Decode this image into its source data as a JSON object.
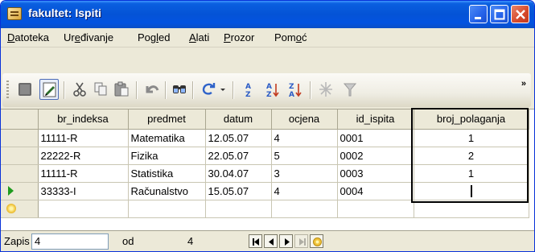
{
  "window": {
    "title": "fakultet: Ispiti"
  },
  "menu": {
    "items": [
      {
        "pre": "",
        "ul": "D",
        "post": "atoteka"
      },
      {
        "pre": "Ur",
        "ul": "e",
        "post": "đivanje"
      },
      {
        "pre": "Pog",
        "ul": "l",
        "post": "ed"
      },
      {
        "pre": "",
        "ul": "A",
        "post": "lati"
      },
      {
        "pre": "",
        "ul": "P",
        "post": "rozor"
      },
      {
        "pre": "Pom",
        "ul": "o",
        "post": "ć"
      }
    ]
  },
  "toolbar": {
    "icons": [
      "view-icon",
      "design-view-icon",
      "cut-icon",
      "copy-icon",
      "paste-icon",
      "undo-icon",
      "find-icon",
      "redo-icon",
      "sort-ascending-icon",
      "sort-descending-icon",
      "filter-by-selection-icon",
      "filter-icon"
    ],
    "overflow": "»"
  },
  "grid": {
    "columns": [
      "br_indeksa",
      "predmet",
      "datum",
      "ocjena",
      "id_ispita",
      "broj_polaganja"
    ],
    "rows": [
      [
        "11111-R",
        "Matematika",
        "12.05.07",
        "4",
        "0001",
        "1"
      ],
      [
        "22222-R",
        "Fizika",
        "22.05.07",
        "5",
        "0002",
        "2"
      ],
      [
        "11111-R",
        "Statistika",
        "30.04.07",
        "3",
        "0003",
        "1"
      ],
      [
        "33333-I",
        "Računalstvo",
        "15.05.07",
        "4",
        "0004",
        ""
      ]
    ]
  },
  "status": {
    "record_label": "Zapis",
    "current_record": "4",
    "of_label": "od",
    "total_records": "4"
  },
  "colors": {
    "titlebar": "#0453d6",
    "close_button": "#d6492a",
    "current_row_arrow": "#1e9b1e"
  }
}
